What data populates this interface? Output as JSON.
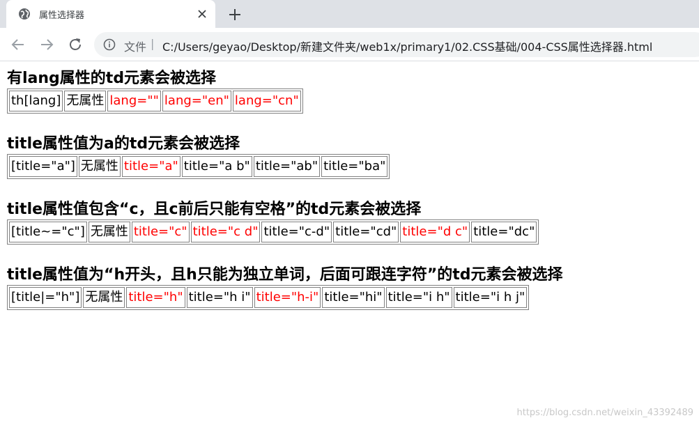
{
  "browser": {
    "tab_title": "属性选择器",
    "address_label": "文件",
    "address_separator": "|",
    "url": "C:/Users/geyao/Desktop/新建文件夹/web1x/primary1/02.CSS基础/004-CSS属性选择器.html"
  },
  "highlight_color": "#ff0000",
  "sections": [
    {
      "heading": "有lang属性的td元素会被选择",
      "cells": [
        "th[lang]",
        "无属性",
        "lang=\"\"",
        "lang=\"en\"",
        "lang=\"cn\""
      ],
      "highlighted": [
        false,
        false,
        true,
        true,
        true
      ]
    },
    {
      "heading": "title属性值为a的td元素会被选择",
      "cells": [
        "[title=\"a\"]",
        "无属性",
        "title=\"a\"",
        "title=\"a b\"",
        "title=\"ab\"",
        "title=\"ba\""
      ],
      "highlighted": [
        false,
        false,
        true,
        false,
        false,
        false
      ]
    },
    {
      "heading": "title属性值包含“c，且c前后只能有空格”的td元素会被选择",
      "cells": [
        "[title~=\"c\"]",
        "无属性",
        "title=\"c\"",
        "title=\"c d\"",
        "title=\"c-d\"",
        "title=\"cd\"",
        "title=\"d c\"",
        "title=\"dc\""
      ],
      "highlighted": [
        false,
        false,
        true,
        true,
        false,
        false,
        true,
        false
      ]
    },
    {
      "heading": "title属性值为“h开头，且h只能为独立单词，后面可跟连字符”的td元素会被选择",
      "cells": [
        "[title|=\"h\"]",
        "无属性",
        "title=\"h\"",
        "title=\"h i\"",
        "title=\"h-i\"",
        "title=\"hi\"",
        "title=\"i h\"",
        "title=\"i h j\""
      ],
      "highlighted": [
        false,
        false,
        true,
        false,
        true,
        false,
        false,
        false
      ]
    }
  ],
  "watermark": "https://blog.csdn.net/weixin_43392489"
}
